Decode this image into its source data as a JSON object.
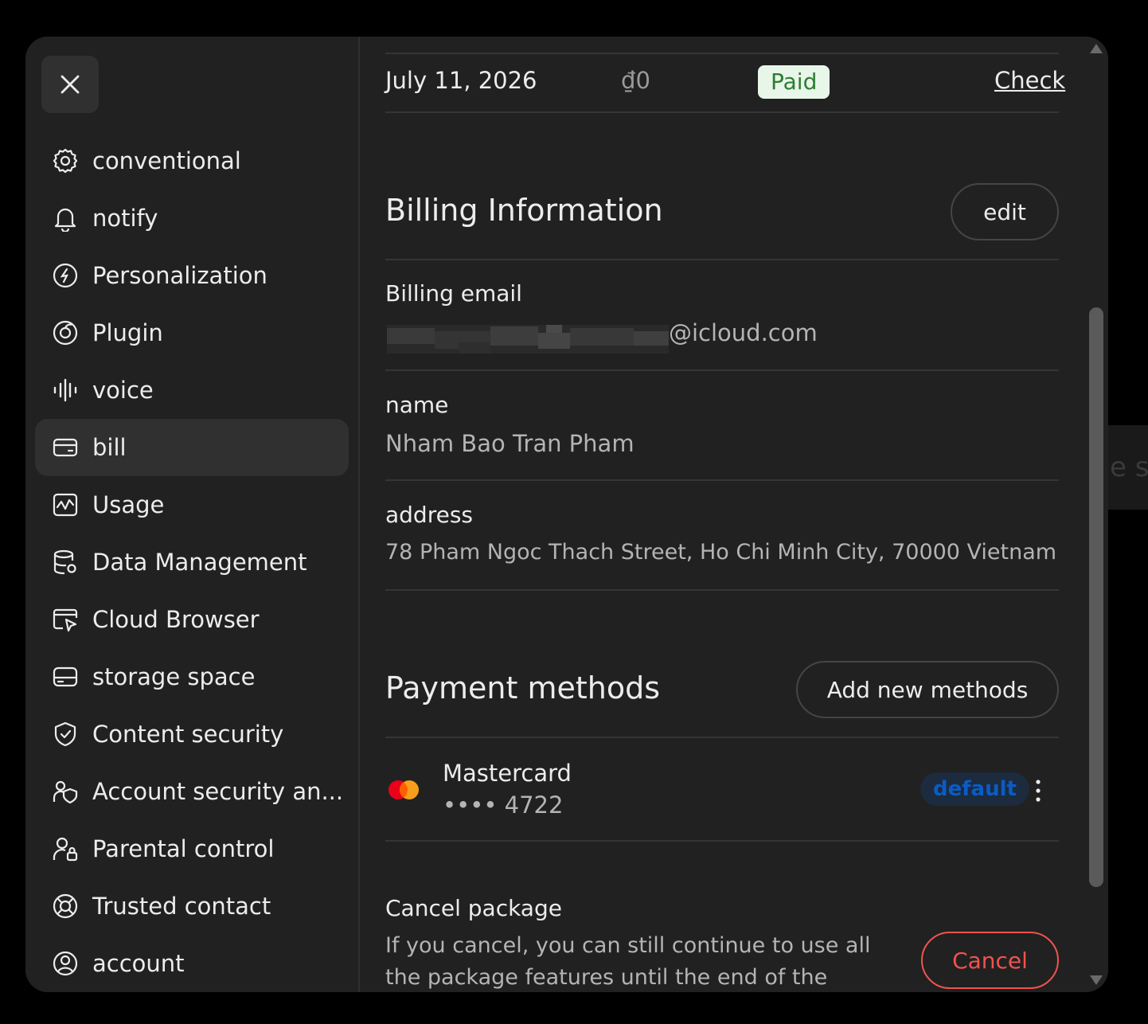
{
  "sidebar": {
    "items": [
      {
        "label": "conventional",
        "icon": "gear-icon"
      },
      {
        "label": "notify",
        "icon": "bell-icon"
      },
      {
        "label": "Personalization",
        "icon": "personalization-icon"
      },
      {
        "label": "Plugin",
        "icon": "plugin-icon"
      },
      {
        "label": "voice",
        "icon": "voice-wave-icon"
      },
      {
        "label": "bill",
        "icon": "credit-card-icon",
        "active": true
      },
      {
        "label": "Usage",
        "icon": "usage-chart-icon"
      },
      {
        "label": "Data Management",
        "icon": "database-gear-icon"
      },
      {
        "label": "Cloud Browser",
        "icon": "cloud-browser-icon"
      },
      {
        "label": "storage space",
        "icon": "storage-drive-icon"
      },
      {
        "label": "Content security",
        "icon": "shield-check-icon"
      },
      {
        "label": "Account security an...",
        "icon": "account-security-icon"
      },
      {
        "label": "Parental control",
        "icon": "parental-lock-icon"
      },
      {
        "label": "Trusted contact",
        "icon": "lifebuoy-icon"
      },
      {
        "label": "account",
        "icon": "user-circle-icon"
      }
    ]
  },
  "invoice": {
    "date": "July 11, 2026",
    "amount": "₫0",
    "status": "Paid",
    "link": "Check"
  },
  "billing": {
    "title": "Billing Information",
    "edit_label": "edit",
    "email_label": "Billing email",
    "email_value": "@icloud.com",
    "name_label": "name",
    "name_value": "Nham Bao Tran Pham",
    "address_label": "address",
    "address_value": "78 Pham Ngoc Thach Street, Ho Chi Minh City, 70000 Vietnam"
  },
  "payment": {
    "title": "Payment methods",
    "add_label": "Add new methods",
    "card_brand": "Mastercard",
    "card_number": "•••• 4722",
    "default_badge": "default"
  },
  "cancel": {
    "title": "Cancel package",
    "description_line1": "If you cancel, you can still continue to use all",
    "description_line2": "the package features until the end of the",
    "button": "Cancel"
  },
  "backdrop_text": "e sp",
  "colors": {
    "accent_green": "#2e7d32",
    "paid_bg": "#e8f5e9",
    "default_badge_bg": "#1c2b3e",
    "default_badge_text": "#0a5cc4",
    "cancel_red": "#ef5350"
  }
}
